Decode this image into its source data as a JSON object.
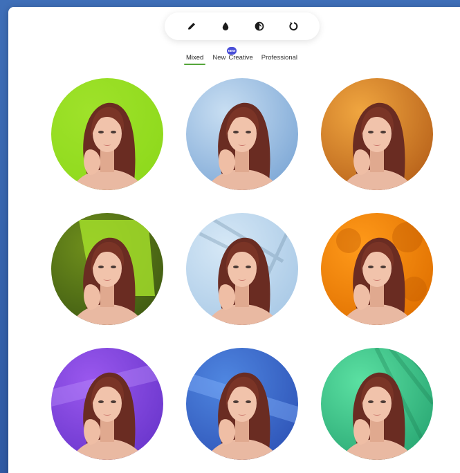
{
  "toolbar": {
    "tools": [
      {
        "icon": "pencil-icon"
      },
      {
        "icon": "drop-icon"
      },
      {
        "icon": "contrast-icon"
      },
      {
        "icon": "reset-icon"
      }
    ]
  },
  "tabs": [
    {
      "label": "Mixed",
      "active": true
    },
    {
      "label": "New"
    },
    {
      "label": "Creative"
    },
    {
      "label": "Professional"
    }
  ],
  "new_badge": "NEW",
  "colors": {
    "accent_underline": "#55a63a",
    "badge": "#4a4fd8"
  },
  "presets": [
    {
      "style": "solid-lime",
      "bg": [
        "#9fe22a",
        "#8ed91c"
      ]
    },
    {
      "style": "soft-blue-gradient",
      "bg": [
        "#c8def2",
        "#7ea8d6"
      ]
    },
    {
      "style": "warm-orange-texture",
      "bg": [
        "#f0a640",
        "#b8621a"
      ]
    },
    {
      "style": "olive-window-light",
      "bg": [
        "#6f8f1c",
        "#3f5a12"
      ]
    },
    {
      "style": "light-blue-palm-shadow",
      "bg": [
        "#d6e8f6",
        "#a9c9e6"
      ]
    },
    {
      "style": "orange-leaf-shadow",
      "bg": [
        "#ff9a1a",
        "#e07000"
      ]
    },
    {
      "style": "violet-light-stripes",
      "bg": [
        "#9a58ee",
        "#6a36cc"
      ]
    },
    {
      "style": "blue-light-stripes",
      "bg": [
        "#4f86e0",
        "#2f55b8"
      ]
    },
    {
      "style": "green-palm-shadow",
      "bg": [
        "#5be0a2",
        "#2aa874"
      ]
    }
  ]
}
